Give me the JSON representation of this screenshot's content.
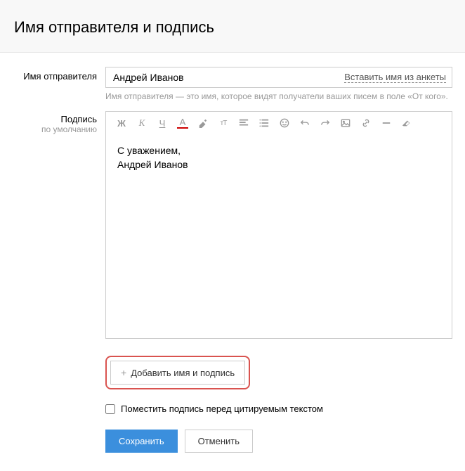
{
  "header": {
    "title": "Имя отправителя и подпись"
  },
  "sender_name": {
    "label": "Имя отправителя",
    "value": "Андрей Иванов",
    "insert_link": "Вставить имя из анкеты",
    "hint": "Имя отправителя — это имя, которое видят получатели ваших писем в поле «От кого»."
  },
  "signature": {
    "label_line1": "Подпись",
    "label_line2": "по умолчанию",
    "text_line1": "С уважением,",
    "text_line2": "Андрей Иванов"
  },
  "toolbar": {
    "bold": "Ж",
    "italic": "К",
    "underline": "Ч",
    "text_color": "A",
    "font_size": "тТ"
  },
  "add_button": {
    "label": "Добавить имя и подпись"
  },
  "checkbox": {
    "label": "Поместить подпись перед цитируемым текстом",
    "checked": false
  },
  "buttons": {
    "save": "Сохранить",
    "cancel": "Отменить"
  }
}
